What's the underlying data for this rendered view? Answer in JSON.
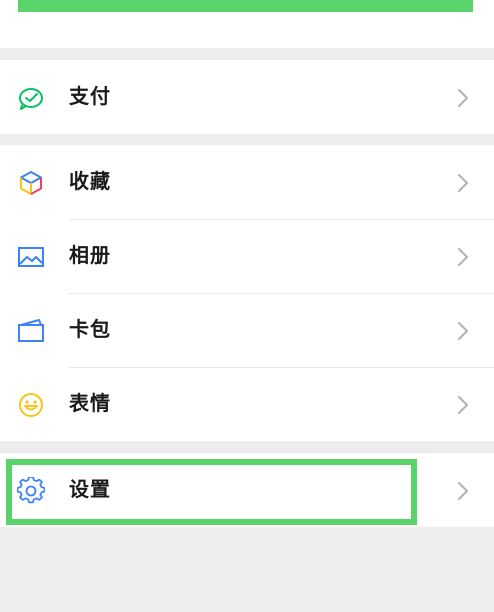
{
  "menu": {
    "pay": {
      "label": "支付",
      "icon": "pay-icon",
      "icon_color": "#07c160"
    },
    "favorites": {
      "label": "收藏",
      "icon": "favorites-cube-icon"
    },
    "album": {
      "label": "相册",
      "icon": "album-icon",
      "icon_color": "#3b82f6"
    },
    "cards": {
      "label": "卡包",
      "icon": "card-wallet-icon",
      "icon_color": "#3b82f6"
    },
    "stickers": {
      "label": "表情",
      "icon": "sticker-smiley-icon",
      "icon_color": "#f5c518"
    },
    "settings": {
      "label": "设置",
      "icon": "settings-gear-icon",
      "icon_color": "#3b82f6"
    }
  },
  "colors": {
    "highlight": "#5ad46a",
    "background": "#ededed",
    "chevron": "#b2b2b2"
  }
}
